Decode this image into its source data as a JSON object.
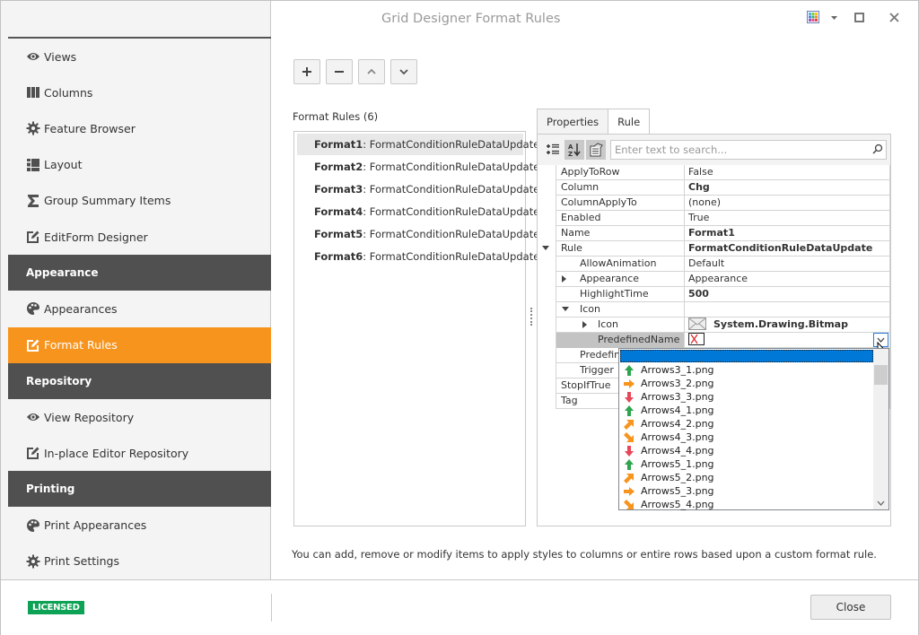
{
  "window": {
    "title": "Grid Designer Format Rules",
    "controls": [
      "skin-palette-icon",
      "dropdown-arrow-icon",
      "maximize-icon",
      "close-icon"
    ]
  },
  "sidebar": {
    "items": [
      {
        "type": "item",
        "label": "Views",
        "icon": "eye-icon"
      },
      {
        "type": "item",
        "label": "Columns",
        "icon": "columns-icon"
      },
      {
        "type": "item",
        "label": "Feature Browser",
        "icon": "gear-icon"
      },
      {
        "type": "item",
        "label": "Layout",
        "icon": "layout-icon"
      },
      {
        "type": "item",
        "label": "Group Summary Items",
        "icon": "sigma-icon"
      },
      {
        "type": "item",
        "label": "EditForm Designer",
        "icon": "edit-icon"
      },
      {
        "type": "header",
        "label": "Appearance"
      },
      {
        "type": "item",
        "label": "Appearances",
        "icon": "palette-icon"
      },
      {
        "type": "item",
        "label": "Format Rules",
        "icon": "edit-icon",
        "active": true
      },
      {
        "type": "header",
        "label": "Repository"
      },
      {
        "type": "item",
        "label": "View Repository",
        "icon": "eye-icon"
      },
      {
        "type": "item",
        "label": "In-place Editor Repository",
        "icon": "edit-icon"
      },
      {
        "type": "header",
        "label": "Printing"
      },
      {
        "type": "item",
        "label": "Print Appearances",
        "icon": "palette-icon"
      },
      {
        "type": "item",
        "label": "Print Settings",
        "icon": "gear-icon"
      }
    ]
  },
  "toolbar": {
    "add": "+",
    "remove": "−",
    "move_up": "up",
    "move_down": "down"
  },
  "rules": {
    "label": "Format Rules (6)",
    "items": [
      {
        "name": "Format1",
        "type": ": FormatConditionRuleDataUpdate",
        "selected": true
      },
      {
        "name": "Format2",
        "type": ": FormatConditionRuleDataUpdate"
      },
      {
        "name": "Format3",
        "type": ": FormatConditionRuleDataUpdate"
      },
      {
        "name": "Format4",
        "type": ": FormatConditionRuleDataUpdate"
      },
      {
        "name": "Format5",
        "type": ": FormatConditionRuleDataUpdate"
      },
      {
        "name": "Format6",
        "type": ": FormatConditionRuleDataUpdate"
      }
    ]
  },
  "properties": {
    "tabs": [
      {
        "label": "Properties",
        "active": true
      },
      {
        "label": "Rule"
      }
    ],
    "search_placeholder": "Enter text to search...",
    "rows": [
      {
        "name": "ApplyToRow",
        "value": "False",
        "level": 0
      },
      {
        "name": "Column",
        "value": "Chg",
        "bold": true,
        "level": 0
      },
      {
        "name": "ColumnApplyTo",
        "value": "(none)",
        "level": 0
      },
      {
        "name": "Enabled",
        "value": "True",
        "level": 0
      },
      {
        "name": "Name",
        "value": "Format1",
        "bold": true,
        "level": 0
      },
      {
        "name": "Rule",
        "value": "FormatConditionRuleDataUpdate",
        "bold": true,
        "level": 0,
        "expander": "down"
      },
      {
        "name": "AllowAnimation",
        "value": "Default",
        "level": 1
      },
      {
        "name": "Appearance",
        "value": "Appearance",
        "level": 1,
        "expander": "right"
      },
      {
        "name": "HighlightTime",
        "value": "500",
        "bold": true,
        "level": 1
      },
      {
        "name": "Icon",
        "value": "",
        "level": 1,
        "expander": "down"
      },
      {
        "name": "Icon",
        "value": "System.Drawing.Bitmap",
        "bold": true,
        "level": 2,
        "expander": "right",
        "value_icon": "bitmap-icon"
      },
      {
        "name": "PredefinedName",
        "value": "",
        "level": 2,
        "focused": true,
        "value_icon": "no-image-icon"
      },
      {
        "name": "Predefine",
        "value": "",
        "level": 1
      },
      {
        "name": "Trigger",
        "value": "",
        "level": 1
      },
      {
        "name": "StopIfTrue",
        "value": "",
        "level": 0
      },
      {
        "name": "Tag",
        "value": "",
        "level": 0
      }
    ]
  },
  "dropdown": {
    "selected_label": "",
    "items": [
      {
        "label": "Arrows3_1.png",
        "icon": "arrow-up-green"
      },
      {
        "label": "Arrows3_2.png",
        "icon": "arrow-right-orange"
      },
      {
        "label": "Arrows3_3.png",
        "icon": "arrow-down-red"
      },
      {
        "label": "Arrows4_1.png",
        "icon": "arrow-up-green"
      },
      {
        "label": "Arrows4_2.png",
        "icon": "arrow-upright-orange"
      },
      {
        "label": "Arrows4_3.png",
        "icon": "arrow-downright-orange"
      },
      {
        "label": "Arrows4_4.png",
        "icon": "arrow-down-red"
      },
      {
        "label": "Arrows5_1.png",
        "icon": "arrow-up-green"
      },
      {
        "label": "Arrows5_2.png",
        "icon": "arrow-upright-orange"
      },
      {
        "label": "Arrows5_3.png",
        "icon": "arrow-right-orange"
      },
      {
        "label": "Arrows5_4.png",
        "icon": "arrow-downright-orange"
      }
    ]
  },
  "hint": "You can add, remove or modify items to apply styles to columns or entire rows based upon a custom format rule.",
  "footer": {
    "badge": "LICENSED",
    "close": "Close"
  },
  "colors": {
    "accent": "#f7941d",
    "header": "#505050",
    "licensed": "#0ea256",
    "selection": "#0078d7",
    "green": "#2ea44f",
    "orange": "#f7941d",
    "red": "#e8465a"
  }
}
